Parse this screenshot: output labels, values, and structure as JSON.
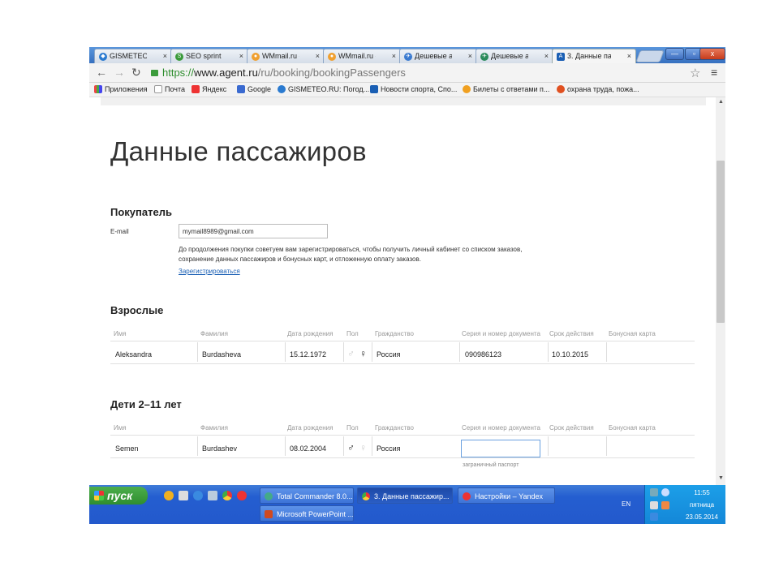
{
  "browser": {
    "tabs": [
      {
        "label": "GISMETEO.RU",
        "active": false
      },
      {
        "label": "SEO sprint",
        "active": false
      },
      {
        "label": "WMmail.ru - сс",
        "active": false
      },
      {
        "label": "WMmail.ru - сс",
        "active": false
      },
      {
        "label": "Дешевые ави",
        "active": false
      },
      {
        "label": "Дешевые ави",
        "active": false
      },
      {
        "label": "3. Данные па",
        "active": true
      }
    ],
    "tab_close": "×",
    "window_buttons": {
      "minimize": "—",
      "maximize": "▫",
      "close": "x"
    },
    "url": {
      "scheme": "https://",
      "host": "www.agent.ru",
      "path": "/ru/booking/bookingPassengers"
    },
    "bookmarks": [
      {
        "label": "Приложения"
      },
      {
        "label": "Почта"
      },
      {
        "label": "Яндекс"
      },
      {
        "label": "Google"
      },
      {
        "label": "GISMETEO.RU: Погод..."
      },
      {
        "label": "Новости спорта, Спо..."
      },
      {
        "label": "Билеты с ответами п..."
      },
      {
        "label": "охрана труда, пожа..."
      }
    ]
  },
  "page": {
    "title": "Данные пассажиров",
    "buyer": {
      "heading": "Покупатель",
      "email_label": "E-mail",
      "email_value": "mymail8989@gmail.com",
      "note_line1": "До продолжения покупки советуем вам зарегистрироваться, чтобы получить личный кабинет со списком заказов,",
      "note_line2": "сохранение данных пассажиров и бонусных карт, и отложенную оплату заказов.",
      "register_link": "Зарегистрироваться"
    },
    "columns": [
      "Имя",
      "Фамилия",
      "Дата рождения",
      "Пол",
      "Гражданство",
      "Серия и номер документа",
      "Срок действия",
      "Бонусная карта"
    ],
    "adults": {
      "heading": "Взрослые",
      "rows": [
        {
          "first": "Aleksandra",
          "last": "Burdasheva",
          "birth": "15.12.1972",
          "gender": "female",
          "citizenship": "Россия",
          "document": "090986123",
          "expiry": "10.10.2015",
          "bonus": ""
        }
      ]
    },
    "children": {
      "heading": "Дети 2–11 лет",
      "rows": [
        {
          "first": "Semen",
          "last": "Burdashev",
          "birth": "08.02.2004",
          "gender": "male",
          "citizenship": "Россия",
          "document": "",
          "expiry": "",
          "bonus": "",
          "doc_hint": "заграничный паспорт"
        }
      ]
    }
  },
  "taskbar": {
    "start": "пуск",
    "tasks": [
      {
        "label": "Total Commander 8.0...",
        "active": false
      },
      {
        "label": "3. Данные пассажир...",
        "active": true
      },
      {
        "label": "Настройки – Yandex",
        "active": false
      },
      {
        "label": "Microsoft PowerPoint ...",
        "active": false
      }
    ],
    "lang": "EN",
    "time": "11:55",
    "day": "пятница",
    "date": "23.05.2014"
  },
  "colors": {
    "accent_link": "#1a5fb4",
    "taskbar": "#245ed0",
    "start": "#3a9a3a"
  }
}
